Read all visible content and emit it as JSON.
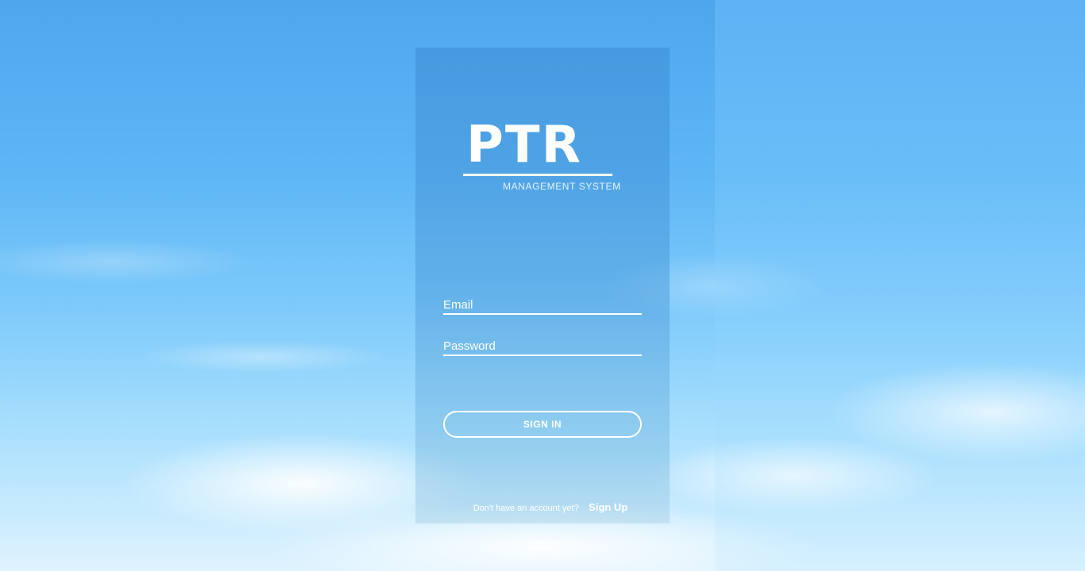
{
  "logo": {
    "title": "PTR",
    "subtitle": "MANAGEMENT SYSTEM"
  },
  "form": {
    "email_placeholder": "Email",
    "email_value": "",
    "password_placeholder": "Password",
    "password_value": "",
    "signin_label": "SIGN IN"
  },
  "footer": {
    "question": "Don't have an account yet?",
    "signup_label": "Sign Up"
  },
  "colors": {
    "text": "#ffffff",
    "sky_top": "#4ea7ee",
    "sky_bottom": "#dff3fe"
  }
}
